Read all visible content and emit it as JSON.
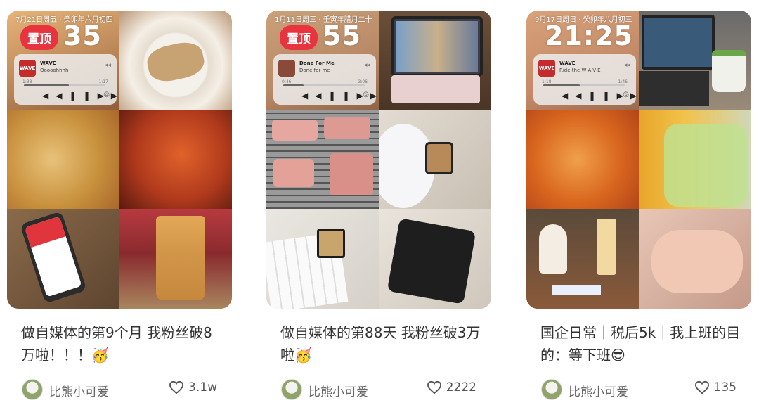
{
  "feed": {
    "cards": [
      {
        "badge": "置顶",
        "lockscreen": {
          "date": "7月21日周五 · 癸卯年六月初四",
          "time": "35"
        },
        "music": {
          "art": "WAVE",
          "title": "WAVE",
          "artist": "Ooooohhhh",
          "time_elapsed": "1:38",
          "time_left": "-1:17",
          "progress": 0.55
        },
        "title": "做自媒体的第9个月 我粉丝破8万啦！！！🥳",
        "author": "比熊小可爱",
        "likes": "3.1w",
        "photo_colors": [
          "#c9a27c",
          "#d8c7a8",
          "#c98e3a",
          "#b5552a",
          "#c0404a",
          "#b86f2e"
        ]
      },
      {
        "badge": "置顶",
        "lockscreen": {
          "date": "1月11日周三 · 壬寅年腊月二十",
          "time": "55"
        },
        "music": {
          "art": "",
          "title": "Done For Me",
          "artist": "Done for me",
          "time_elapsed": "0:46",
          "time_left": "-3:06",
          "progress": 0.25
        },
        "title": "做自媒体的第88天 我粉丝破3万啦🥳",
        "author": "比熊小可爱",
        "likes": "2222",
        "photo_colors": [
          "#6b4f3a",
          "#5c6070",
          "#b9574f",
          "#d6c7b8",
          "#e9e4dc",
          "#2a2a2a"
        ]
      },
      {
        "badge": "",
        "lockscreen": {
          "date": "9月17日周日 · 癸卯年八月初三",
          "time": "21:25"
        },
        "music": {
          "art": "WAVE",
          "title": "WAVE",
          "artist": "Ride the W-A-V-E",
          "time_elapsed": "1:18",
          "time_left": "-1:46",
          "progress": 0.45
        },
        "title": "国企日常｜税后5k｜我上班的目的：等下班😎",
        "author": "比熊小可爱",
        "likes": "135",
        "photo_colors": [
          "#8a6a4a",
          "#6b6b6b",
          "#d9661e",
          "#b9d98a",
          "#8a5a3a",
          "#d8a898"
        ]
      }
    ]
  }
}
